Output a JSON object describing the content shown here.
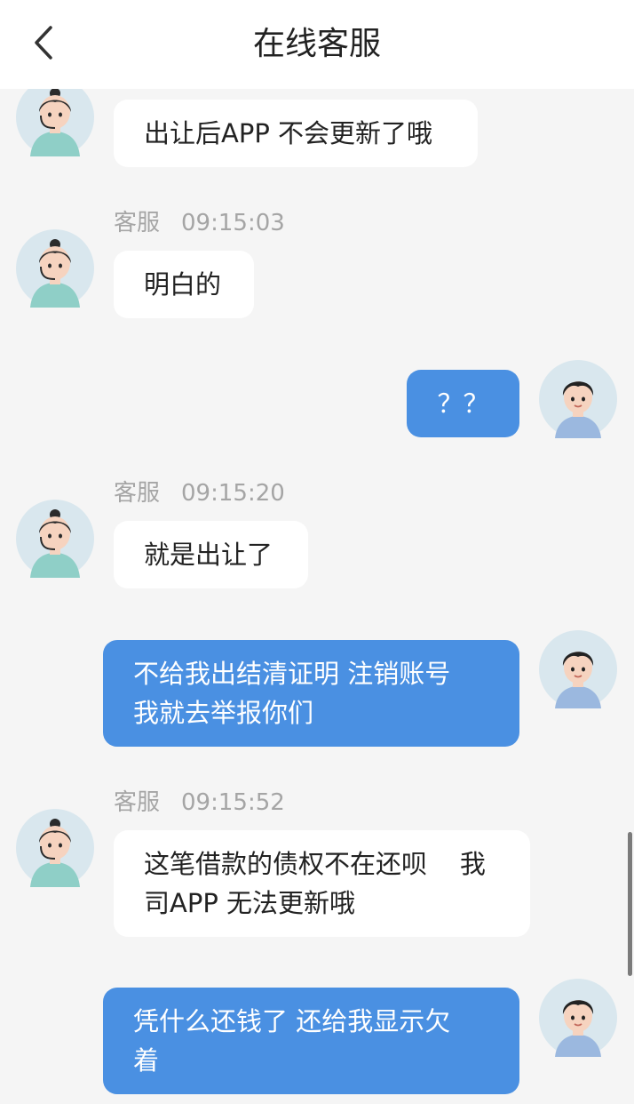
{
  "header": {
    "title": "在线客服",
    "back_icon": "chevron-left-icon"
  },
  "agent_name": "客服",
  "messages": [
    {
      "side": "in",
      "text": "出让后APP 不会更新了哦"
    },
    {
      "side": "in",
      "sender": "客服",
      "time": "09:15:03",
      "text": "明白的"
    },
    {
      "side": "out",
      "text": "？？"
    },
    {
      "side": "in",
      "sender": "客服",
      "time": "09:15:20",
      "text": "就是出让了"
    },
    {
      "side": "out",
      "text": "不给我出结清证明 注销账号\n我就去举报你们"
    },
    {
      "side": "in",
      "sender": "客服",
      "time": "09:15:52",
      "text": "这笔借款的债权不在还呗    我\n司APP 无法更新哦"
    },
    {
      "side": "out",
      "text": "凭什么还钱了 还给我显示欠\n着"
    }
  ],
  "colors": {
    "header_bg": "#ffffff",
    "chat_bg": "#f5f5f5",
    "incoming_bubble": "#ffffff",
    "outgoing_bubble": "#4a90e2",
    "meta_text": "#a5a5a5"
  },
  "icons": {
    "agent_avatar": "customer-service-agent-avatar",
    "user_avatar": "user-avatar"
  }
}
